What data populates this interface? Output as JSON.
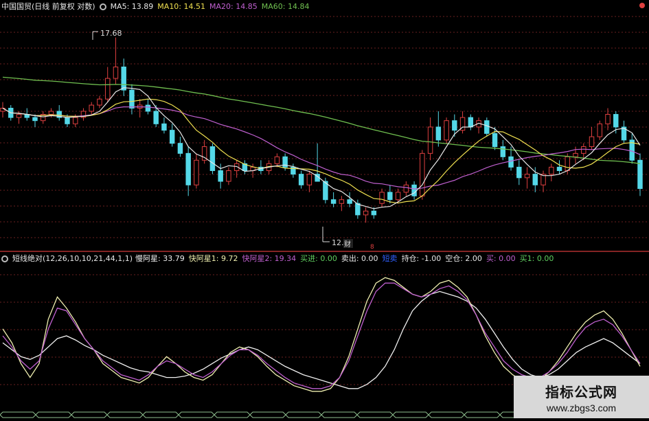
{
  "colors": {
    "background": "#000000",
    "grid": "#6b1f1f",
    "divider": "#b03030",
    "candle_up": "#e04040",
    "candle_down": "#54d8e8",
    "ma5": "#e8e8e8",
    "ma10": "#f0e050",
    "ma20": "#c060d0",
    "ma60": "#70c050",
    "osc_slow": "#f0f0f0",
    "osc_fast1": "#f0f0b0",
    "osc_fast2": "#c060d0"
  },
  "top_header": {
    "title": "中国国贸(日线 前复权 对数)",
    "ma5": "MA5: 13.89",
    "ma10": "MA10: 14.51",
    "ma20": "MA20: 14.85",
    "ma60": "MA60: 14.84"
  },
  "annotations": {
    "high_label": "17.68",
    "low_label": "12.",
    "fin_label": "财",
    "marker_label": "8"
  },
  "bottom_header": {
    "indicator": "短线绝对(12,26,10,10,21,44,1,1)",
    "slow": "慢阿星: 33.79",
    "fast1": "快阿星1: 9.72",
    "fast2": "快阿星2: 19.34",
    "buy_in": "买进: 0.00",
    "sell_out": "卖出: 0.00",
    "short_sell": "短卖",
    "holding": "持仓: -1.00",
    "empty": "空仓: 2.00",
    "buy": "买: 0.00",
    "buy1": "买1: 0.00"
  },
  "watermark": {
    "title": "指标公式网",
    "url": "www.zbgs3.com"
  },
  "chart_data": [
    {
      "type": "candlestick",
      "title": "中国国贸(日线 前复权 对数)",
      "ylim": [
        11.8,
        18.6
      ],
      "candles": [
        [
          15.1,
          15.4,
          14.9,
          15.2
        ],
        [
          15.2,
          15.3,
          14.8,
          14.9
        ],
        [
          14.9,
          15.1,
          14.7,
          15.0
        ],
        [
          15.0,
          15.2,
          14.8,
          14.9
        ],
        [
          14.9,
          15.0,
          14.6,
          14.8
        ],
        [
          14.8,
          15.1,
          14.7,
          15.0
        ],
        [
          15.0,
          15.2,
          14.9,
          15.1
        ],
        [
          15.1,
          15.3,
          14.8,
          14.9
        ],
        [
          14.9,
          15.0,
          14.6,
          14.7
        ],
        [
          14.7,
          15.0,
          14.6,
          14.9
        ],
        [
          14.9,
          15.2,
          14.8,
          15.1
        ],
        [
          15.1,
          15.4,
          15.0,
          15.3
        ],
        [
          15.3,
          15.6,
          15.2,
          15.5
        ],
        [
          15.5,
          16.6,
          15.4,
          16.2
        ],
        [
          16.2,
          17.68,
          16.0,
          16.6
        ],
        [
          16.6,
          16.9,
          15.6,
          15.8
        ],
        [
          15.8,
          16.0,
          15.0,
          15.2
        ],
        [
          15.2,
          15.5,
          14.9,
          15.3
        ],
        [
          15.3,
          15.5,
          15.0,
          15.1
        ],
        [
          15.1,
          15.3,
          14.6,
          14.7
        ],
        [
          14.7,
          14.9,
          14.4,
          14.5
        ],
        [
          14.5,
          14.7,
          14.0,
          14.1
        ],
        [
          14.1,
          14.3,
          13.7,
          13.8
        ],
        [
          13.8,
          14.0,
          12.6,
          12.9
        ],
        [
          12.9,
          13.8,
          12.8,
          13.6
        ],
        [
          13.6,
          14.2,
          13.5,
          14.0
        ],
        [
          14.0,
          14.1,
          13.2,
          13.3
        ],
        [
          13.3,
          13.5,
          12.8,
          13.0
        ],
        [
          13.0,
          13.4,
          12.9,
          13.3
        ],
        [
          13.3,
          13.6,
          13.1,
          13.5
        ],
        [
          13.5,
          13.6,
          13.2,
          13.3
        ],
        [
          13.3,
          13.5,
          13.1,
          13.4
        ],
        [
          13.4,
          13.6,
          13.2,
          13.3
        ],
        [
          13.3,
          13.6,
          13.2,
          13.5
        ],
        [
          13.5,
          13.8,
          13.4,
          13.7
        ],
        [
          13.7,
          13.8,
          13.3,
          13.4
        ],
        [
          13.4,
          13.5,
          13.1,
          13.2
        ],
        [
          13.2,
          13.3,
          12.8,
          12.9
        ],
        [
          12.9,
          13.3,
          12.7,
          13.2
        ],
        [
          13.2,
          14.1,
          13.0,
          13.0
        ],
        [
          13.0,
          13.1,
          12.4,
          12.5
        ],
        [
          12.5,
          12.7,
          12.3,
          12.4
        ],
        [
          12.4,
          12.6,
          12.2,
          12.5
        ],
        [
          12.5,
          12.7,
          12.3,
          12.4
        ],
        [
          12.4,
          12.5,
          12.0,
          12.1
        ],
        [
          12.1,
          12.3,
          11.9,
          12.2
        ],
        [
          12.2,
          12.3,
          12.0,
          12.1
        ],
        [
          12.4,
          12.8,
          12.3,
          12.7
        ],
        [
          12.7,
          12.9,
          12.4,
          12.5
        ],
        [
          12.5,
          12.8,
          12.4,
          12.7
        ],
        [
          12.7,
          13.0,
          12.6,
          12.9
        ],
        [
          12.9,
          13.0,
          12.5,
          12.6
        ],
        [
          12.6,
          13.9,
          12.5,
          13.8
        ],
        [
          13.8,
          14.9,
          13.6,
          14.6
        ],
        [
          14.6,
          15.1,
          14.0,
          14.2
        ],
        [
          14.2,
          14.9,
          14.1,
          14.8
        ],
        [
          14.8,
          15.0,
          14.3,
          14.5
        ],
        [
          14.5,
          15.1,
          14.4,
          14.9
        ],
        [
          14.9,
          15.0,
          14.5,
          14.6
        ],
        [
          14.6,
          14.9,
          14.4,
          14.8
        ],
        [
          14.8,
          14.9,
          14.3,
          14.4
        ],
        [
          14.4,
          14.6,
          13.9,
          14.0
        ],
        [
          14.0,
          14.2,
          13.6,
          13.7
        ],
        [
          13.7,
          14.0,
          13.3,
          13.4
        ],
        [
          13.4,
          13.6,
          12.9,
          13.1
        ],
        [
          13.1,
          13.4,
          12.8,
          13.2
        ],
        [
          13.2,
          13.4,
          12.7,
          12.9
        ],
        [
          12.9,
          13.3,
          12.7,
          13.2
        ],
        [
          13.2,
          13.5,
          13.0,
          13.4
        ],
        [
          13.4,
          13.6,
          13.2,
          13.3
        ],
        [
          13.3,
          13.8,
          13.2,
          13.7
        ],
        [
          13.7,
          14.0,
          13.5,
          13.8
        ],
        [
          13.8,
          14.1,
          13.6,
          14.0
        ],
        [
          14.0,
          14.6,
          13.9,
          14.3
        ],
        [
          14.3,
          14.8,
          14.2,
          14.7
        ],
        [
          14.7,
          15.2,
          14.5,
          15.0
        ],
        [
          15.0,
          15.1,
          14.4,
          14.6
        ],
        [
          14.6,
          14.8,
          14.1,
          14.2
        ],
        [
          14.2,
          14.4,
          13.5,
          13.6
        ],
        [
          13.6,
          13.8,
          12.6,
          12.8
        ]
      ],
      "ma_lines": [
        "MA5",
        "MA10",
        "MA20",
        "MA60"
      ]
    },
    {
      "type": "line",
      "title": "短线绝对(12,26,10,10,21,44,1,1)",
      "ylim": [
        0,
        100
      ],
      "series": [
        {
          "name": "慢阿星",
          "values": [
            45,
            40,
            35,
            33,
            36,
            42,
            48,
            50,
            47,
            43,
            40,
            36,
            33,
            30,
            27,
            25,
            24,
            22,
            20,
            20,
            21,
            23,
            26,
            30,
            34,
            37,
            40,
            42,
            40,
            36,
            32,
            28,
            25,
            22,
            20,
            18,
            16,
            14,
            12,
            12,
            15,
            20,
            28,
            40,
            55,
            68,
            75,
            80,
            82,
            80,
            78,
            75,
            70,
            62,
            52,
            42,
            33,
            26,
            22,
            20,
            22,
            26,
            32,
            38,
            42,
            45,
            48,
            45,
            40,
            35,
            30
          ]
        },
        {
          "name": "快阿星1",
          "values": [
            55,
            45,
            30,
            20,
            30,
            62,
            78,
            70,
            60,
            48,
            40,
            30,
            25,
            20,
            18,
            16,
            20,
            28,
            35,
            30,
            24,
            20,
            18,
            22,
            30,
            38,
            42,
            40,
            35,
            28,
            22,
            18,
            14,
            12,
            10,
            10,
            12,
            20,
            35,
            55,
            75,
            88,
            92,
            90,
            85,
            80,
            78,
            82,
            88,
            90,
            85,
            78,
            65,
            50,
            38,
            28,
            22,
            18,
            16,
            18,
            24,
            32,
            42,
            52,
            60,
            65,
            68,
            62,
            52,
            40,
            28
          ]
        },
        {
          "name": "快阿星2",
          "values": [
            50,
            42,
            32,
            26,
            32,
            55,
            70,
            68,
            58,
            48,
            40,
            32,
            27,
            22,
            20,
            18,
            22,
            28,
            32,
            30,
            26,
            22,
            20,
            24,
            30,
            36,
            40,
            40,
            36,
            30,
            25,
            20,
            16,
            14,
            12,
            12,
            14,
            20,
            32,
            50,
            68,
            82,
            88,
            88,
            84,
            80,
            78,
            80,
            84,
            86,
            82,
            76,
            65,
            52,
            42,
            32,
            26,
            22,
            20,
            20,
            24,
            30,
            38,
            48,
            56,
            60,
            62,
            58,
            50,
            40,
            30
          ]
        }
      ]
    }
  ]
}
